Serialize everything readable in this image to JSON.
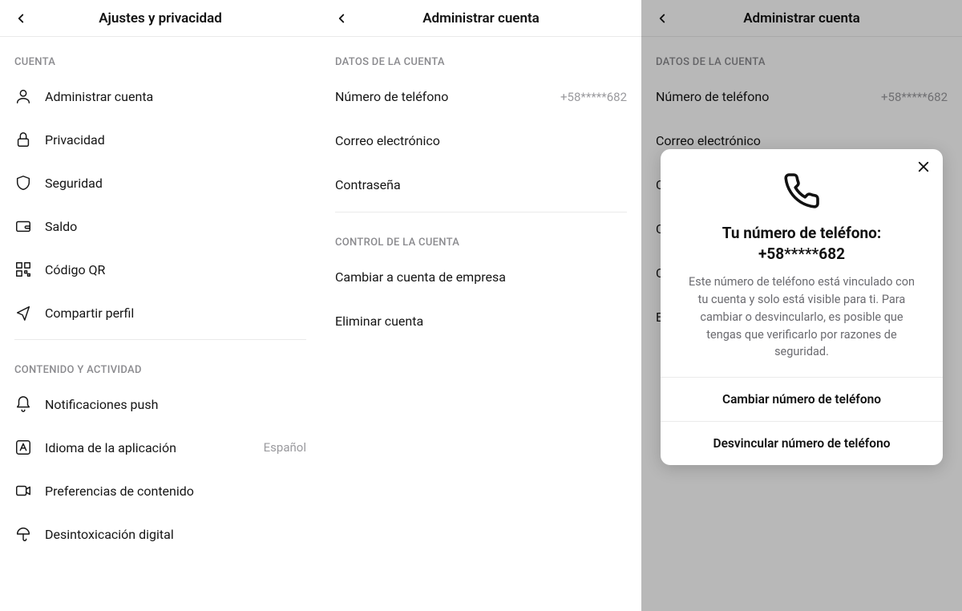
{
  "panel1": {
    "title": "Ajustes y privacidad",
    "section1": "CUENTA",
    "rows1": [
      {
        "label": "Administrar cuenta"
      },
      {
        "label": "Privacidad"
      },
      {
        "label": "Seguridad"
      },
      {
        "label": "Saldo"
      },
      {
        "label": "Código QR"
      },
      {
        "label": "Compartir perfil"
      }
    ],
    "section2": "CONTENIDO Y ACTIVIDAD",
    "rows2": [
      {
        "label": "Notificaciones push"
      },
      {
        "label": "Idioma de la aplicación",
        "value": "Español"
      },
      {
        "label": "Preferencias de contenido"
      },
      {
        "label": "Desintoxicación digital"
      }
    ]
  },
  "panel2": {
    "title": "Administrar cuenta",
    "section1": "DATOS DE LA CUENTA",
    "rows1": [
      {
        "label": "Número de teléfono",
        "value": "+58*****682"
      },
      {
        "label": "Correo electrónico"
      },
      {
        "label": "Contraseña"
      }
    ],
    "section2": "CONTROL DE LA CUENTA",
    "rows2": [
      {
        "label": "Cambiar a cuenta de empresa"
      },
      {
        "label": "Eliminar cuenta"
      }
    ]
  },
  "panel3": {
    "title": "Administrar cuenta",
    "section1": "DATOS DE LA CUENTA",
    "rows1": [
      {
        "label": "Número de teléfono",
        "value": "+58*****682"
      },
      {
        "label": "Correo electrónico"
      }
    ],
    "peek": [
      "Co",
      "Co",
      "Ca",
      "El"
    ],
    "modal": {
      "title": "Tu número de teléfono: +58*****682",
      "body": "Este número de teléfono está vinculado con tu cuenta y solo está visible para ti. Para cambiar o desvincularlo, es posible que tengas que verificarlo por razones de seguridad.",
      "btn1": "Cambiar número de teléfono",
      "btn2": "Desvincular número de teléfono"
    }
  }
}
